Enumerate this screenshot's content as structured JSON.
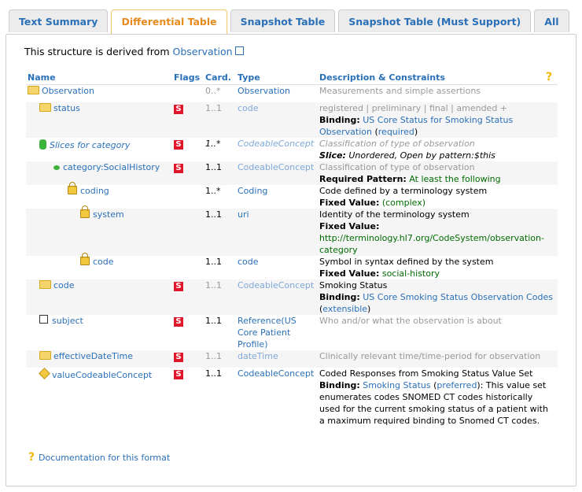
{
  "tabs": [
    {
      "label": "Text Summary",
      "active": false
    },
    {
      "label": "Differential Table",
      "active": true
    },
    {
      "label": "Snapshot Table",
      "active": false
    },
    {
      "label": "Snapshot Table (Must Support)",
      "active": false
    },
    {
      "label": "All",
      "active": false
    }
  ],
  "derived": {
    "prefix": "This structure is derived from ",
    "link": "Observation"
  },
  "columns": {
    "name": "Name",
    "flags": "Flags",
    "card": "Card.",
    "type": "Type",
    "desc": "Description & Constraints"
  },
  "rows": [
    {
      "name": "Observation",
      "flag": "",
      "card": "0..*",
      "type": "Observation",
      "desc": "Measurements and simple assertions"
    },
    {
      "name": "status",
      "flag": "S",
      "card": "1..1",
      "type": "code",
      "desc1": "registered | preliminary | final | amended +",
      "binding_label": "Binding:",
      "binding_link": "US Core Status for Smoking Status Observation",
      "strength": "required"
    },
    {
      "name": "Slices for category",
      "flag": "S",
      "card": "1..*",
      "type": "CodeableConcept",
      "desc1": "Classification of type of observation",
      "slice_label": "Slice:",
      "slice_text": "Unordered, Open by pattern:$this"
    },
    {
      "name": "category:SocialHistory",
      "flag": "S",
      "card": "1..1",
      "type": "CodeableConcept",
      "desc1": "Classification of type of observation",
      "rp_label": "Required Pattern:",
      "rp_value": "At least the following"
    },
    {
      "name": "coding",
      "flag": "",
      "card": "1..*",
      "type": "Coding",
      "desc1": "Code defined by a terminology system",
      "fv_label": "Fixed Value:",
      "fv_value": "(complex)"
    },
    {
      "name": "system",
      "flag": "",
      "card": "1..1",
      "type": "uri",
      "desc1": "Identity of the terminology system",
      "fv_label": "Fixed Value:",
      "fv_value": "http://terminology.hl7.org/CodeSystem/observation-category"
    },
    {
      "name": "code",
      "flag": "",
      "card": "1..1",
      "type": "code",
      "desc1": "Symbol in syntax defined by the system",
      "fv_label": "Fixed Value:",
      "fv_value": "social-history"
    },
    {
      "name": "code",
      "flag": "S",
      "card": "1..1",
      "type": "CodeableConcept",
      "desc1": "Smoking Status",
      "binding_label": "Binding:",
      "binding_link": "US Core Smoking Status Observation Codes",
      "strength": "extensible"
    },
    {
      "name": "subject",
      "flag": "S",
      "card": "1..1",
      "type_prefix": "Reference(",
      "type": "US Core Patient Profile",
      "type_suffix": ")",
      "desc": "Who and/or what the observation is about"
    },
    {
      "name": "effectiveDateTime",
      "flag": "S",
      "card": "1..1",
      "type": "dateTime",
      "desc": "Clinically relevant time/time-period for observation"
    },
    {
      "name": "valueCodeableConcept",
      "flag": "S",
      "card": "1..1",
      "type": "CodeableConcept",
      "desc1": "Coded Responses from Smoking Status Value Set",
      "binding_label": "Binding:",
      "binding_link": "Smoking Status",
      "strength": "preferred",
      "binding_rest": ": This value set enumerates codes SNOMED CT codes historically used for the current smoking status of a patient with a maximum required binding to Snomed CT codes."
    }
  ],
  "doc_link": "Documentation for this format",
  "colors": {
    "link": "#2a70b8",
    "active_tab": "#e68a1e",
    "flag": "#e0162b",
    "fixed": "#006b00"
  }
}
